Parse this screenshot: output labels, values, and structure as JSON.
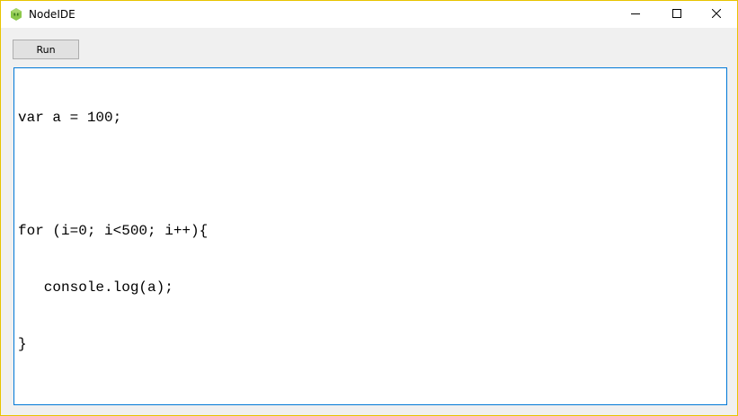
{
  "window": {
    "title": "NodeIDE",
    "icon": "node-js-hexagon-icon",
    "border_color": "#e8c400"
  },
  "title_controls": {
    "minimize": "minimize-icon",
    "maximize": "maximize-icon",
    "close": "close-icon"
  },
  "toolbar": {
    "run_label": "Run"
  },
  "editor": {
    "lines": [
      "var a = 100;",
      "",
      "for (i=0; i<500; i++){",
      "   console.log(a);",
      "}"
    ],
    "border_color": "#0078d7"
  }
}
